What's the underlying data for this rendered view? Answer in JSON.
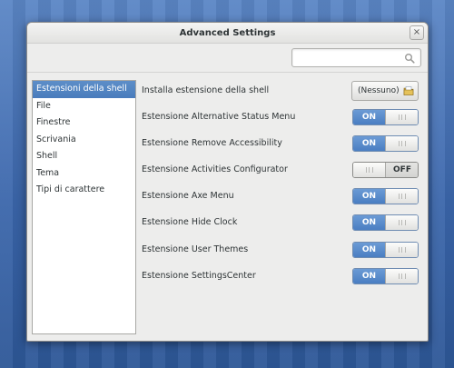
{
  "window": {
    "title": "Advanced Settings",
    "close_glyph": "×"
  },
  "search": {
    "value": "",
    "placeholder": ""
  },
  "sidebar": {
    "items": [
      {
        "label": "Estensioni della shell",
        "selected": true
      },
      {
        "label": "File",
        "selected": false
      },
      {
        "label": "Finestre",
        "selected": false
      },
      {
        "label": "Scrivania",
        "selected": false
      },
      {
        "label": "Shell",
        "selected": false
      },
      {
        "label": "Tema",
        "selected": false
      },
      {
        "label": "Tipi di carattere",
        "selected": false
      }
    ]
  },
  "content": {
    "install": {
      "label": "Installa estensione della shell",
      "button_label": "(Nessuno)",
      "icon": "folder-icon"
    },
    "extensions": [
      {
        "label": "Estensione Alternative Status Menu",
        "state": "ON"
      },
      {
        "label": "Estensione Remove Accessibility",
        "state": "ON"
      },
      {
        "label": "Estensione Activities Configurator",
        "state": "OFF"
      },
      {
        "label": "Estensione Axe Menu",
        "state": "ON"
      },
      {
        "label": "Estensione Hide Clock",
        "state": "ON"
      },
      {
        "label": "Estensione User Themes",
        "state": "ON"
      },
      {
        "label": "Estensione SettingsCenter",
        "state": "ON"
      }
    ]
  },
  "colors": {
    "accent": "#4a7cbc",
    "window_bg": "#ededec",
    "desktop": "#3b66ab"
  }
}
